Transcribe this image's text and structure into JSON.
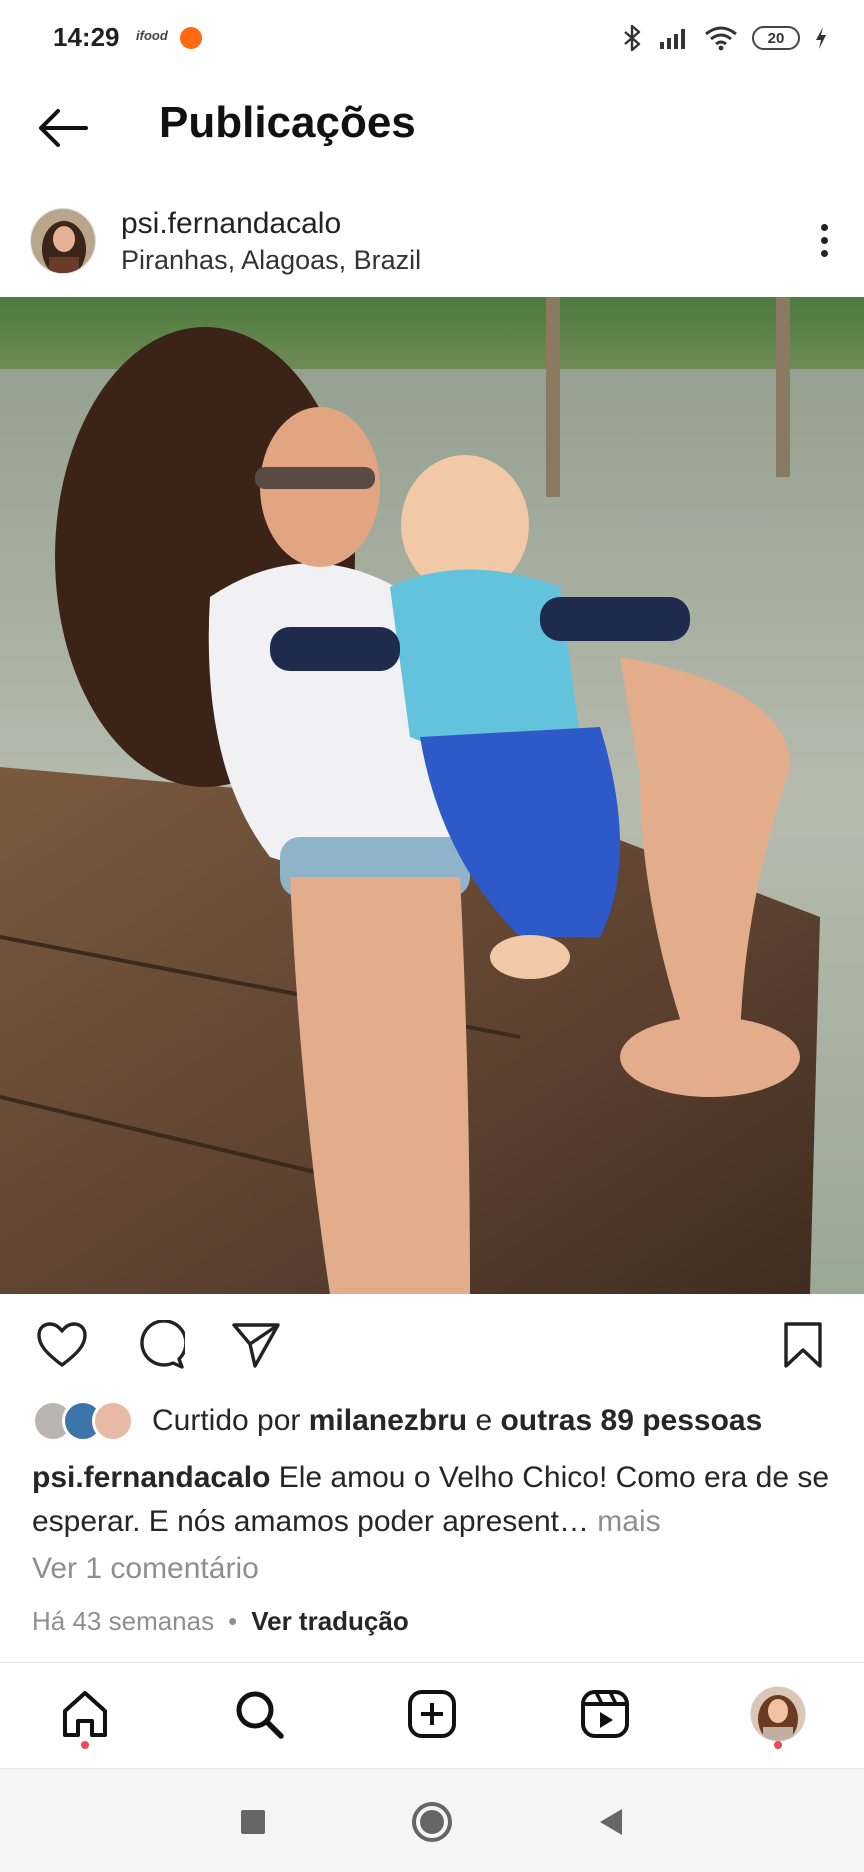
{
  "status_bar": {
    "time": "14:29",
    "ifood_label": "ifood",
    "battery": "20",
    "icons": [
      "bluetooth-icon",
      "signal-icon",
      "wifi-icon",
      "battery-icon",
      "charging-icon"
    ]
  },
  "header": {
    "title": "Publicações",
    "back_icon": "arrow-left-icon"
  },
  "post": {
    "username": "psi.fernandacalo",
    "location": "Piranhas, Alagoas, Brazil",
    "likes": {
      "prefix": "Curtido por ",
      "user": "milanezbru",
      "middle": " e ",
      "others": "outras 89 pessoas"
    },
    "caption": {
      "username": "psi.fernandacalo",
      "text": " Ele amou o Velho Chico! Como era de se esperar. E nós amamos poder apresent…",
      "more": " mais"
    },
    "comments_link": "Ver 1 comentário",
    "time_ago": "Há 43 semanas",
    "separator": "•",
    "translate": "Ver tradução"
  },
  "colors": {
    "accent_red": "#ed4956",
    "muted": "#8e8e8e",
    "text": "#262626"
  },
  "bottom_nav": {
    "items": [
      "home-icon",
      "search-icon",
      "add-post-icon",
      "reels-icon",
      "profile-avatar"
    ]
  },
  "system_nav": {
    "items": [
      "recent-apps-icon",
      "home-circle-icon",
      "back-triangle-icon"
    ]
  }
}
